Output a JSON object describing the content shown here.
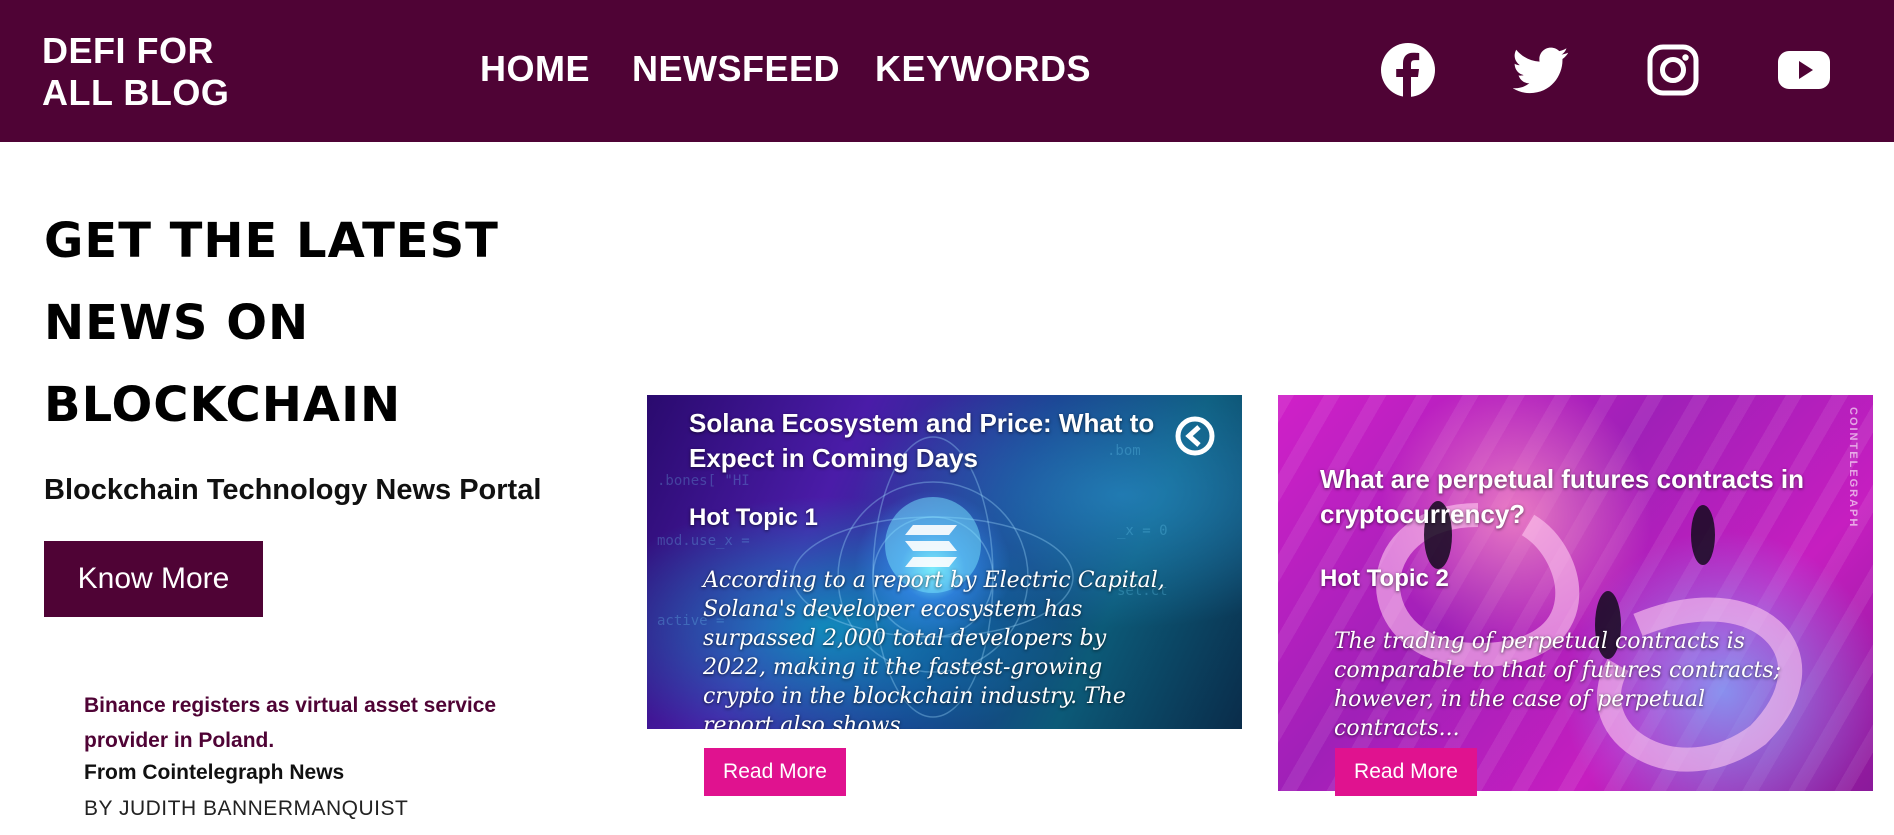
{
  "navbar": {
    "brand": "DEFI FOR ALL BLOG",
    "links": [
      "HOME",
      "NEWSFEED",
      "KEYWORDS"
    ],
    "social_icons": [
      "facebook-icon",
      "twitter-icon",
      "instagram-icon",
      "youtube-icon"
    ]
  },
  "hero": {
    "title": "GET THE LATEST NEWS ON BLOCKCHAIN",
    "subtitle": "Blockchain Technology News Portal",
    "cta_label": "Know More"
  },
  "news_item": {
    "headline": "Binance registers as virtual asset service provider in Poland.",
    "source": "From Cointelegraph News",
    "author": "BY JUDITH BANNERMANQUIST"
  },
  "cards": [
    {
      "title": "Solana Ecosystem and Price: What to Expect in Coming Days",
      "topic": "Hot Topic 1",
      "excerpt": "According to a report by Electric Capital, Solana's developer ecosystem has surpassed 2,000 total developers by 2022, making it the fastest-growing crypto in the blockchain industry. The report also shows...",
      "button": "Read More"
    },
    {
      "title": "What are perpetual futures contracts in cryptocurrency?",
      "topic": "Hot Topic 2",
      "excerpt": "The trading of perpetual contracts is comparable to that of futures contracts; however, in the case of perpetual contracts...",
      "button": "Read More",
      "watermark": "COINTELEGRAPH"
    }
  ],
  "colors": {
    "primary": "#4f0335",
    "accent": "#e0128f"
  }
}
